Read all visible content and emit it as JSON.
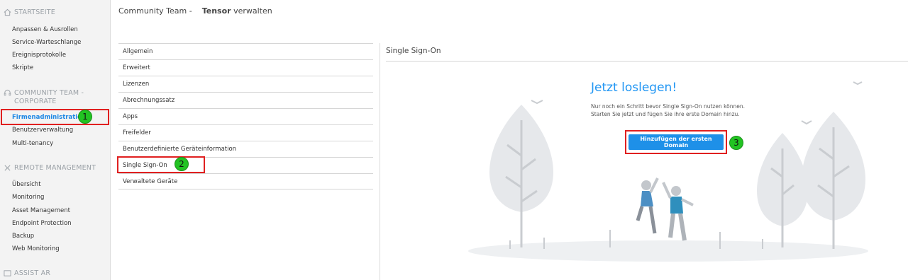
{
  "sidebar": {
    "sections": [
      {
        "title": "STARTSEITE",
        "icon": "home-icon",
        "items": [
          "Anpassen & Ausrollen",
          "Service-Warteschlange",
          "Ereignisprotokolle",
          "Skripte"
        ]
      },
      {
        "title": "COMMUNITY TEAM -",
        "title2": "CORPORATE",
        "icon": "headset-icon",
        "items": [
          "Firmenadministration",
          "Benutzerverwaltung",
          "Multi-tenancy"
        ]
      },
      {
        "title": "REMOTE MANAGEMENT",
        "icon": "tools-icon",
        "items": [
          "Übersicht",
          "Monitoring",
          "Asset Management",
          "Endpoint Protection",
          "Backup",
          "Web Monitoring"
        ]
      },
      {
        "title": "ASSIST AR",
        "icon": "display-icon",
        "items": []
      }
    ],
    "active_item": "Firmenadministration"
  },
  "header": {
    "prefix": "Community Team -",
    "tensor": "Tensor",
    "suffix": "verwalten"
  },
  "settings": {
    "items": [
      "Allgemein",
      "Erweitert",
      "Lizenzen",
      "Abrechnungssatz",
      "Apps",
      "Freifelder",
      "Benutzerdefinierte Geräteinformation",
      "Single Sign-On",
      "Verwaltete Geräte"
    ],
    "selected": "Single Sign-On"
  },
  "panel": {
    "title": "Single Sign-On",
    "cta_title": "Jetzt loslegen!",
    "cta_text": "Nur noch ein Schritt bevor Single Sign-On nutzen können. Starten Sie jetzt und fügen Sie ihre erste Domain hinzu.",
    "button_label": "Hinzufügen der ersten Domain"
  },
  "annotations": {
    "step1": "1",
    "step2": "2",
    "step3": "3"
  },
  "colors": {
    "accent": "#1e90e8",
    "highlight": "#e02020",
    "badge": "#22c322"
  }
}
